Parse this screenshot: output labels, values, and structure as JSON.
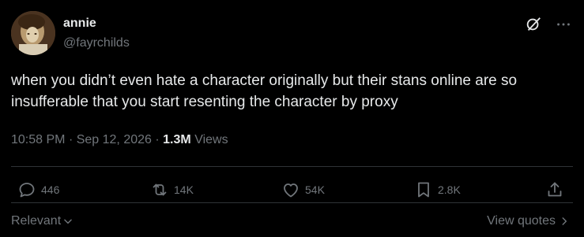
{
  "author": {
    "display_name": "annie",
    "handle": "@fayrchilds"
  },
  "tweet": {
    "text": "when you didn’t even hate a character originally but their stans online are so insufferable that you start resenting the character by proxy",
    "time": "10:58 PM",
    "date": "Sep 12, 2026",
    "views_count": "1.3M",
    "views_label": "Views"
  },
  "actions": {
    "replies": "446",
    "reposts": "14K",
    "likes": "54K",
    "bookmarks": "2.8K"
  },
  "footer": {
    "sort_label": "Relevant",
    "view_quotes_label": "View quotes"
  },
  "icons": {
    "header": [
      "grok-icon",
      "more-options-icon"
    ],
    "actions": [
      "reply-icon",
      "repost-icon",
      "like-icon",
      "bookmark-icon",
      "share-icon"
    ]
  },
  "colors": {
    "background": "#000000",
    "primary_text": "#e7e9ea",
    "secondary_text": "#71767b",
    "divider": "#2f3336"
  }
}
